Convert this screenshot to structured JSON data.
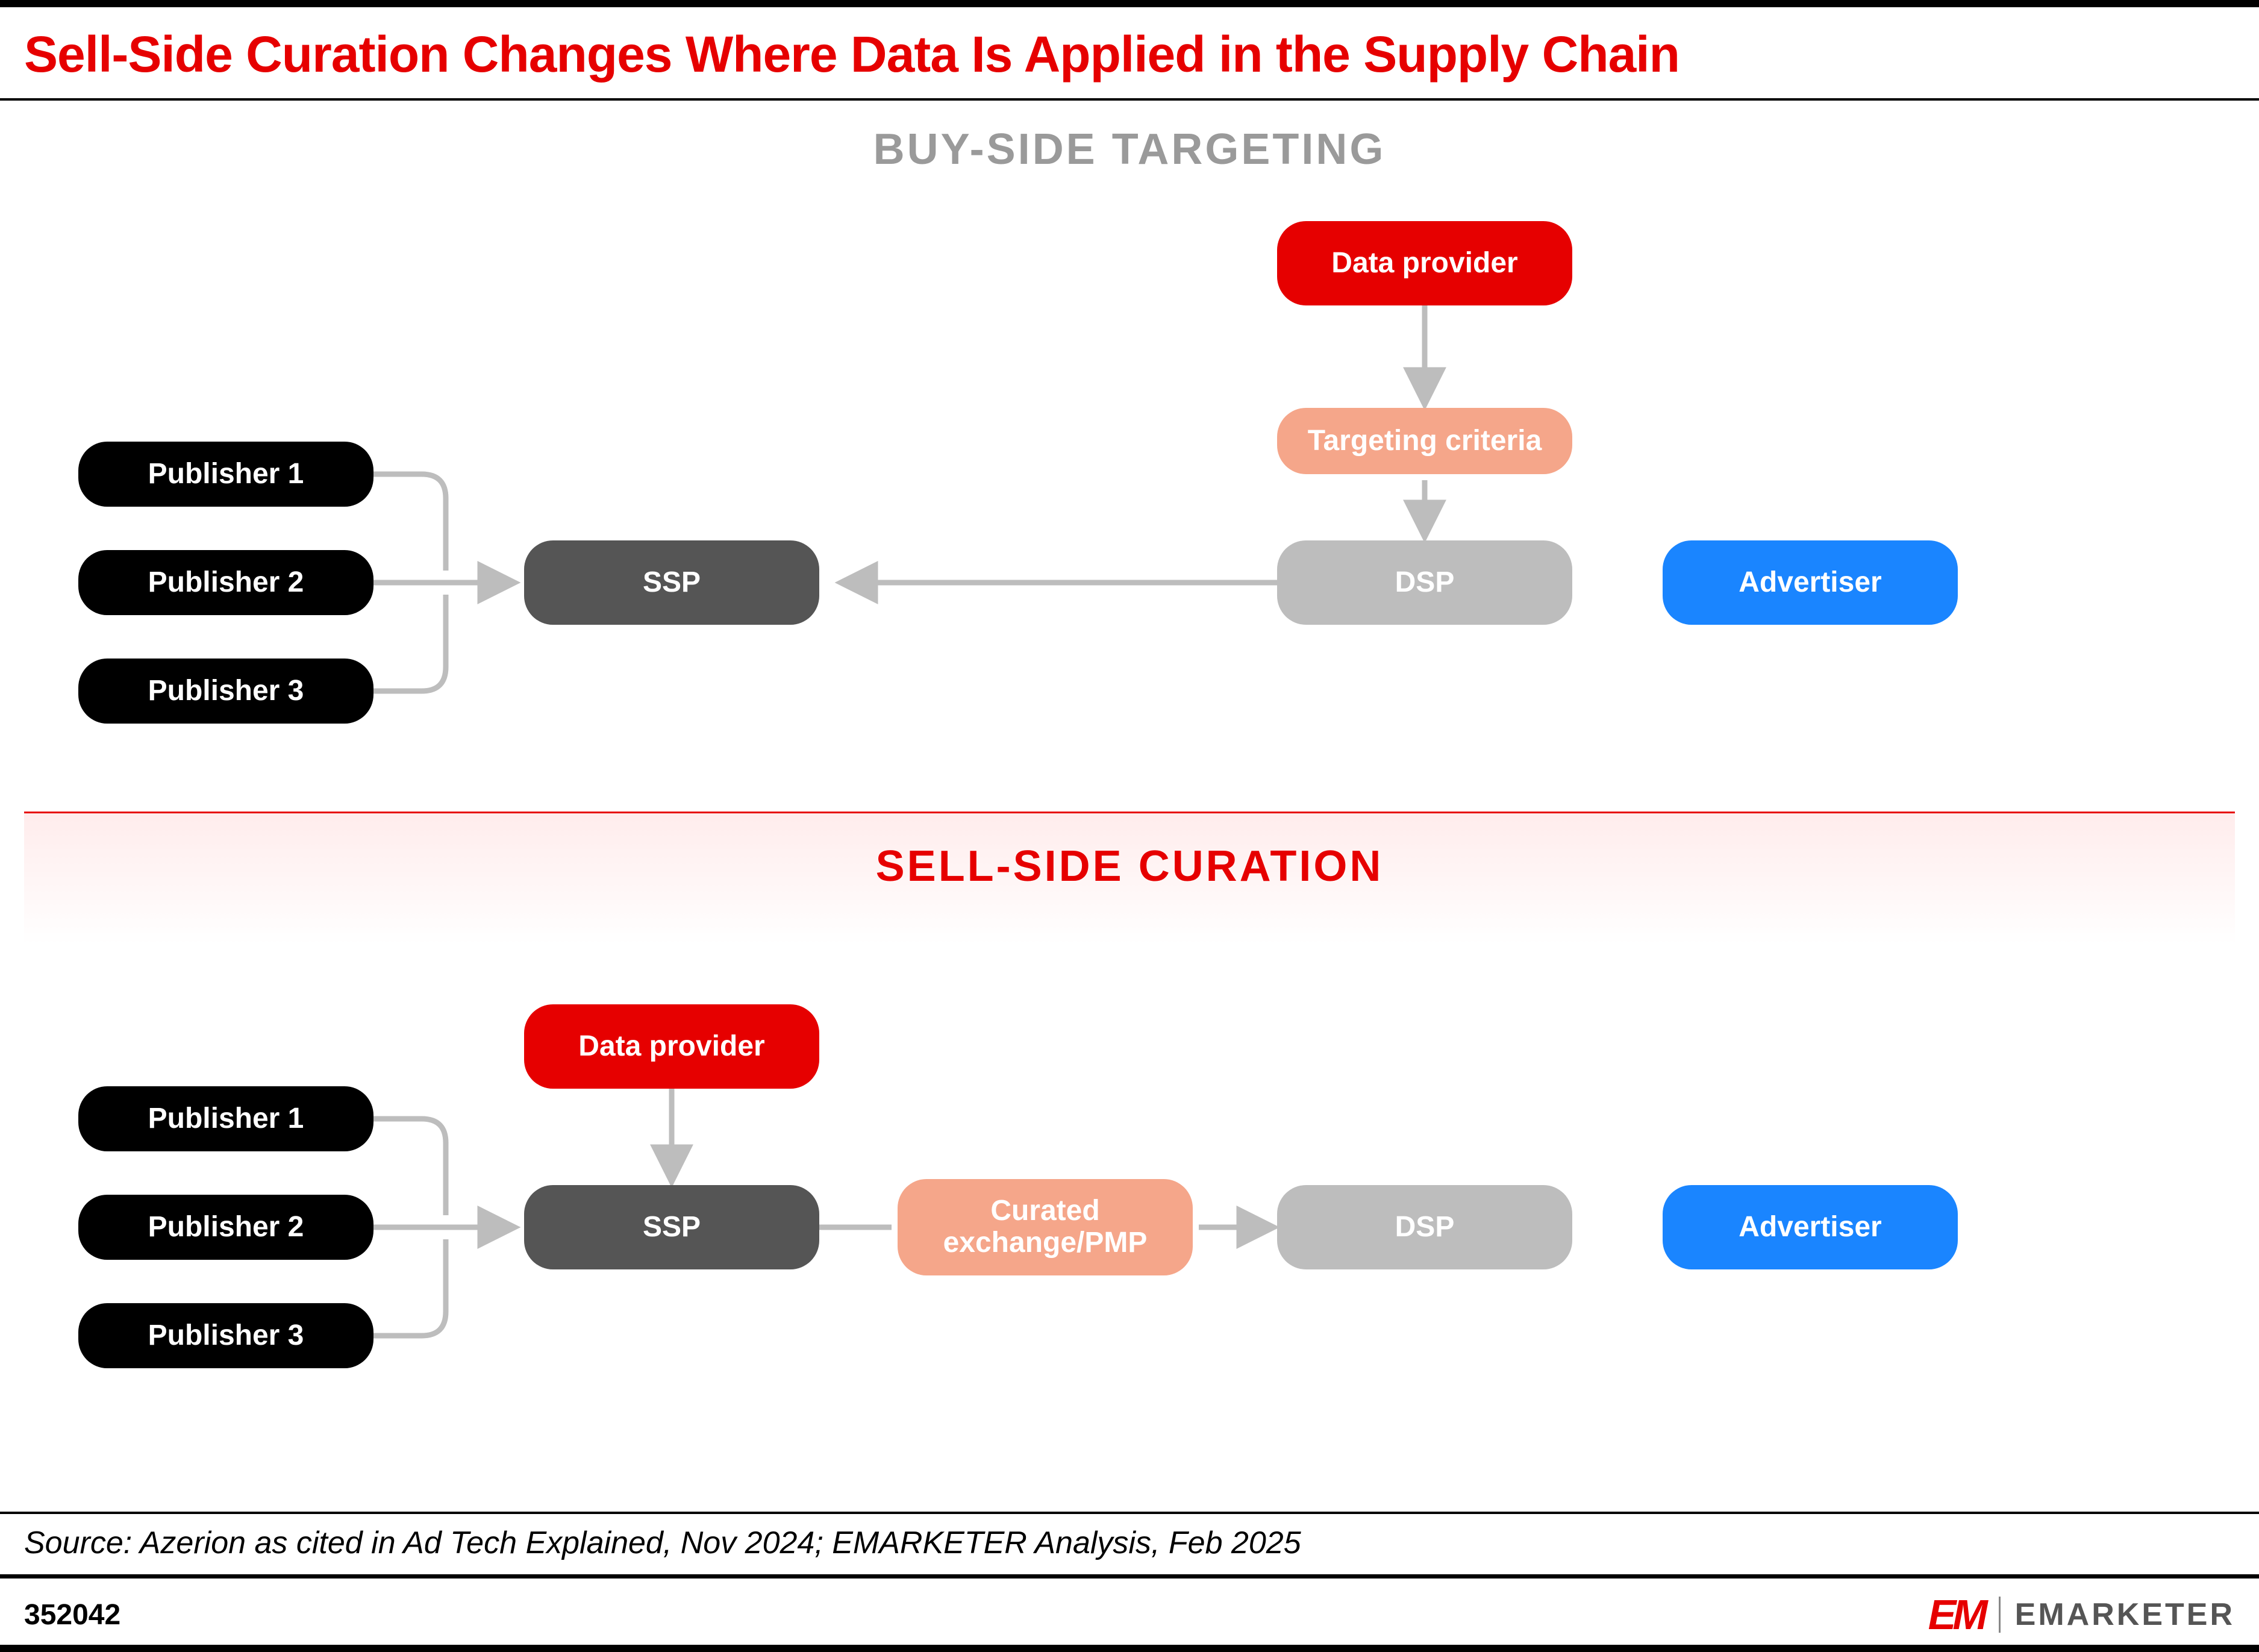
{
  "title": "Sell-Side Curation Changes Where Data Is Applied in the Supply Chain",
  "sections": {
    "buy_side": {
      "label": "BUY-SIDE TARGETING",
      "nodes": {
        "publishers": [
          "Publisher 1",
          "Publisher 2",
          "Publisher 3"
        ],
        "ssp": "SSP",
        "dsp": "DSP",
        "advertiser": "Advertiser",
        "data_provider": "Data provider",
        "targeting_criteria": "Targeting criteria"
      },
      "flows": [
        {
          "from": "publishers",
          "to": "ssp"
        },
        {
          "from": "dsp",
          "to": "ssp"
        },
        {
          "from": "data_provider",
          "to": "targeting_criteria"
        },
        {
          "from": "targeting_criteria",
          "to": "dsp"
        }
      ]
    },
    "sell_side": {
      "label": "SELL-SIDE CURATION",
      "nodes": {
        "publishers": [
          "Publisher 1",
          "Publisher 2",
          "Publisher 3"
        ],
        "ssp": "SSP",
        "curated": "Curated exchange/PMP",
        "dsp": "DSP",
        "advertiser": "Advertiser",
        "data_provider": "Data provider"
      },
      "flows": [
        {
          "from": "publishers",
          "to": "ssp"
        },
        {
          "from": "data_provider",
          "to": "ssp"
        },
        {
          "from": "ssp",
          "to": "curated"
        },
        {
          "from": "curated",
          "to": "dsp"
        }
      ]
    }
  },
  "source": "Source: Azerion as cited in Ad Tech Explained, Nov 2024; EMARKETER Analysis, Feb 2025",
  "chart_id": "352042",
  "branding": {
    "mark": "EM",
    "name": "EMARKETER"
  },
  "colors": {
    "accent_red": "#e60000",
    "publisher": "#000000",
    "ssp": "#555555",
    "dsp": "#bdbdbd",
    "advertiser": "#1a85ff",
    "data_provider": "#e60000",
    "light_orange": "#f5a68a",
    "arrow": "#bdbdbd"
  }
}
